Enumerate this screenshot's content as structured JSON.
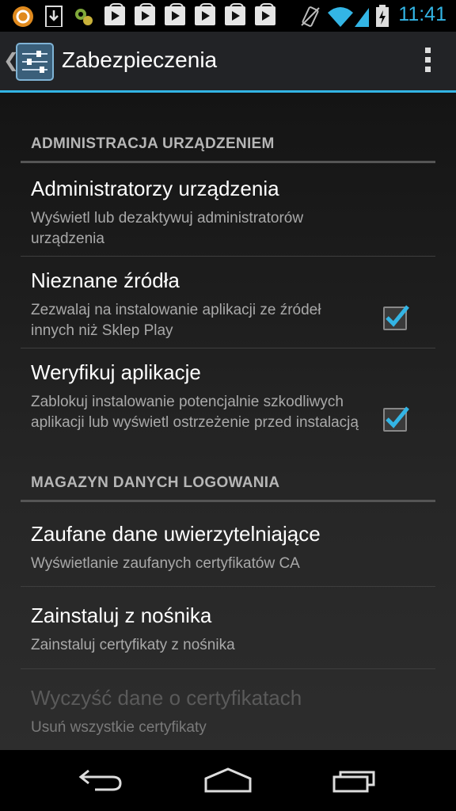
{
  "status_bar": {
    "time": "11:41",
    "icons": [
      "app-notification-icon",
      "download-icon",
      "settings-notification-icon",
      "play-store-icon",
      "play-store-icon",
      "play-store-icon",
      "play-store-icon",
      "play-store-icon",
      "play-store-icon",
      "vibrate-icon",
      "wifi-icon",
      "signal-icon",
      "battery-charging-icon"
    ],
    "accent_color": "#33b5e5"
  },
  "action_bar": {
    "title": "Zabezpieczenia",
    "icon": "settings-sliders-icon",
    "menu_icon": "overflow-menu-icon"
  },
  "sections": [
    {
      "title": "ADMINISTRACJA URZĄDZENIEM",
      "items": [
        {
          "title": "Administratorzy urządzenia",
          "subtitle": "Wyświetl lub dezaktywuj administratorów urządzenia"
        },
        {
          "title": "Nieznane źródła",
          "subtitle": "Zezwalaj na instalowanie aplikacji ze źródeł innych niż Sklep Play",
          "checked": true
        },
        {
          "title": "Weryfikuj aplikacje",
          "subtitle": "Zablokuj instalowanie potencjalnie szkodliwych aplikacji lub wyświetl ostrzeżenie przed instalacją",
          "checked": true
        }
      ]
    },
    {
      "title": "MAGAZYN DANYCH LOGOWANIA",
      "items": [
        {
          "title": "Zaufane dane uwierzytelniające",
          "subtitle": "Wyświetlanie zaufanych certyfikatów CA"
        },
        {
          "title": "Zainstaluj z nośnika",
          "subtitle": "Zainstaluj certyfikaty z nośnika"
        },
        {
          "title": "Wyczyść dane o certyfikatach",
          "subtitle": "Usuń wszystkie certyfikaty",
          "disabled": true
        }
      ]
    }
  ],
  "nav_bar": {
    "buttons": [
      "back-icon",
      "home-icon",
      "recent-apps-icon"
    ]
  }
}
